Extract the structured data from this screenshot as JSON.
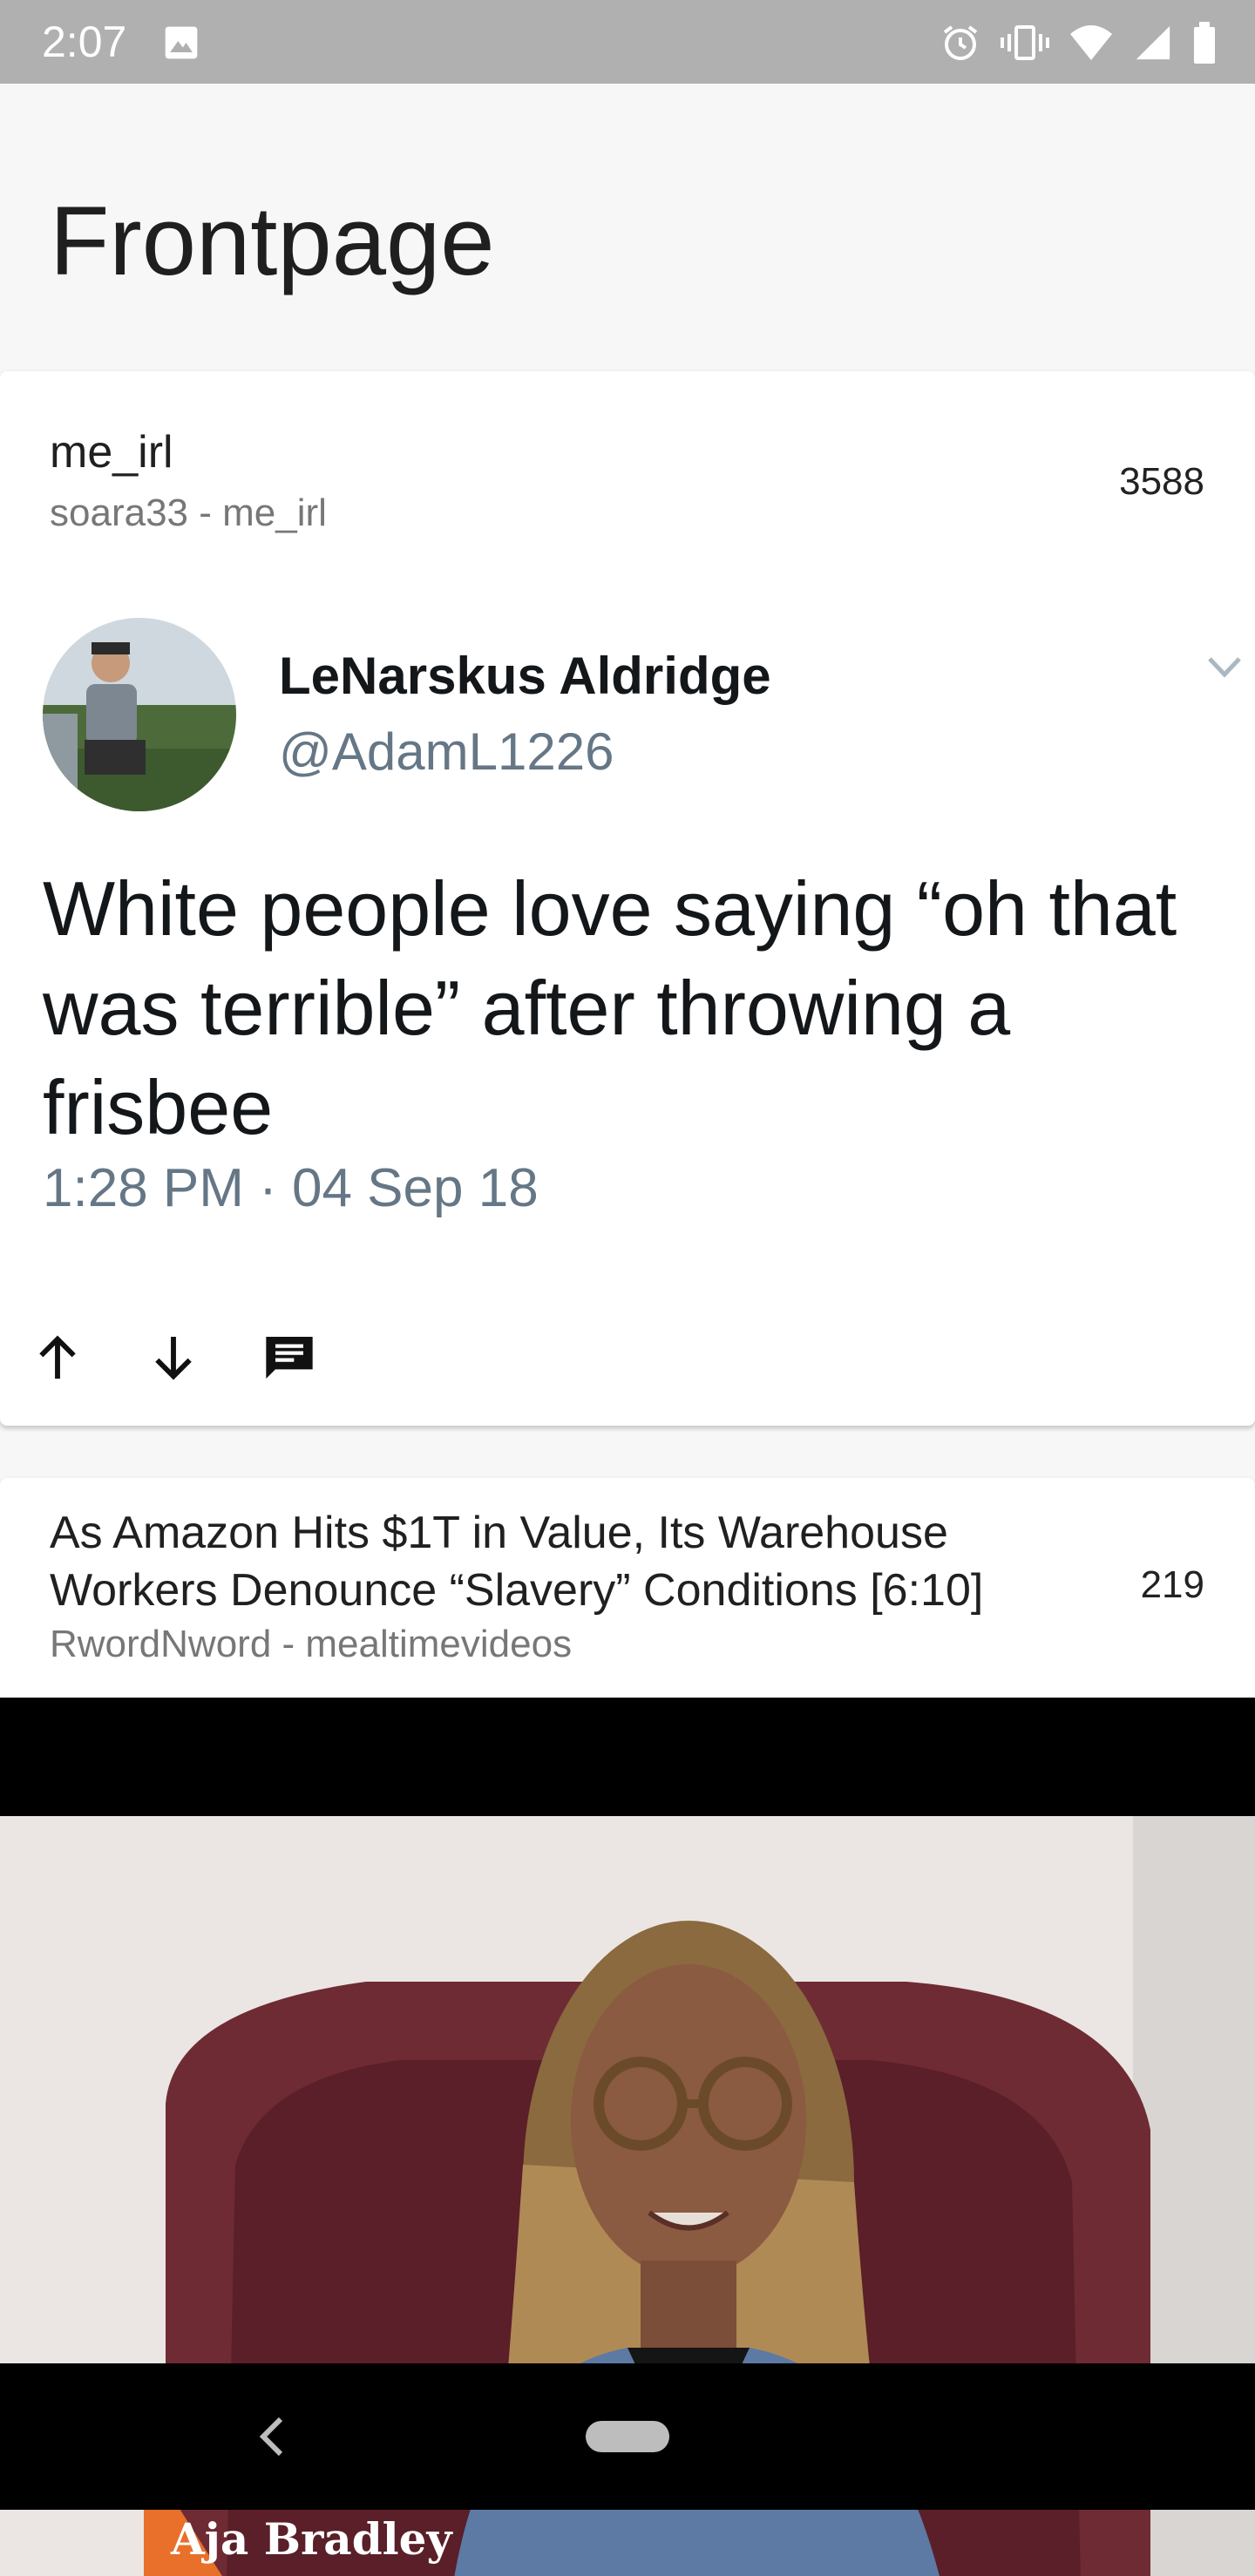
{
  "status_bar": {
    "time": "2:07",
    "icons": [
      "image-icon",
      "alarm-icon",
      "vibrate-icon",
      "wifi-icon",
      "signal-icon",
      "battery-icon"
    ]
  },
  "header": {
    "title": "Frontpage"
  },
  "posts": [
    {
      "title": "me_irl",
      "meta": "soara33 - me_irl",
      "score": "3588",
      "tweet": {
        "name": "LeNarskus Aldridge",
        "handle": "@AdamL1226",
        "text": "White people love saying “oh that was terrible” after throwing a frisbee",
        "time": "1:28 PM · 04 Sep 18"
      },
      "actions": [
        "upvote-icon",
        "downvote-icon",
        "comment-icon"
      ]
    },
    {
      "title": "As Amazon Hits $1T in Value, Its Warehouse Workers Denounce “Slavery” Conditions [6:10]",
      "meta": "RwordNword - mealtimevideos",
      "score": "219",
      "video": {
        "lower_third": "Aja Bradley"
      }
    }
  ],
  "colors": {
    "status_bar": "#b0b0b0",
    "background": "#f7f7f7",
    "twitter_gray": "#657786",
    "twitter_black": "#14171a",
    "lower_third_orange": "#e8702a"
  }
}
